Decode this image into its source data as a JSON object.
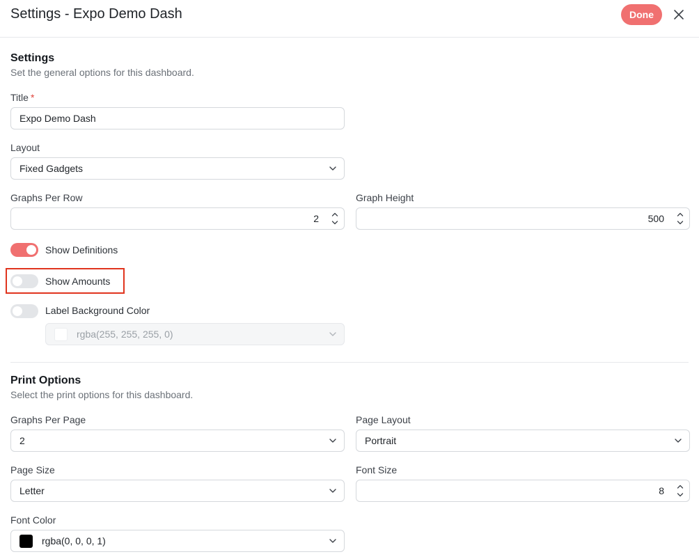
{
  "header": {
    "title": "Settings - Expo Demo Dash",
    "done_label": "Done",
    "close_icon": "close-icon"
  },
  "settings": {
    "title": "Settings",
    "subtitle": "Set the general options for this dashboard.",
    "title_label": "Title",
    "title_required_mark": "*",
    "title_value": "Expo Demo Dash",
    "layout_label": "Layout",
    "layout_value": "Fixed Gadgets",
    "graphs_per_row_label": "Graphs Per Row",
    "graphs_per_row_value": "2",
    "graph_height_label": "Graph Height",
    "graph_height_value": "500",
    "show_definitions_label": "Show Definitions",
    "show_definitions_on": true,
    "show_amounts_label": "Show Amounts",
    "show_amounts_on": false,
    "label_bg_label": "Label Background Color",
    "label_bg_on": false,
    "label_bg_value": "rgba(255, 255, 255, 0)",
    "label_bg_swatch": "#ffffff"
  },
  "print": {
    "title": "Print Options",
    "subtitle": "Select the print options for this dashboard.",
    "graphs_per_page_label": "Graphs Per Page",
    "graphs_per_page_value": "2",
    "page_layout_label": "Page Layout",
    "page_layout_value": "Portrait",
    "page_size_label": "Page Size",
    "page_size_value": "Letter",
    "font_size_label": "Font Size",
    "font_size_value": "8",
    "font_color_label": "Font Color",
    "font_color_value": "rgba(0, 0, 0, 1)",
    "font_color_swatch": "#000000"
  },
  "colors": {
    "accent": "#f07070",
    "highlight": "#e0341e"
  }
}
